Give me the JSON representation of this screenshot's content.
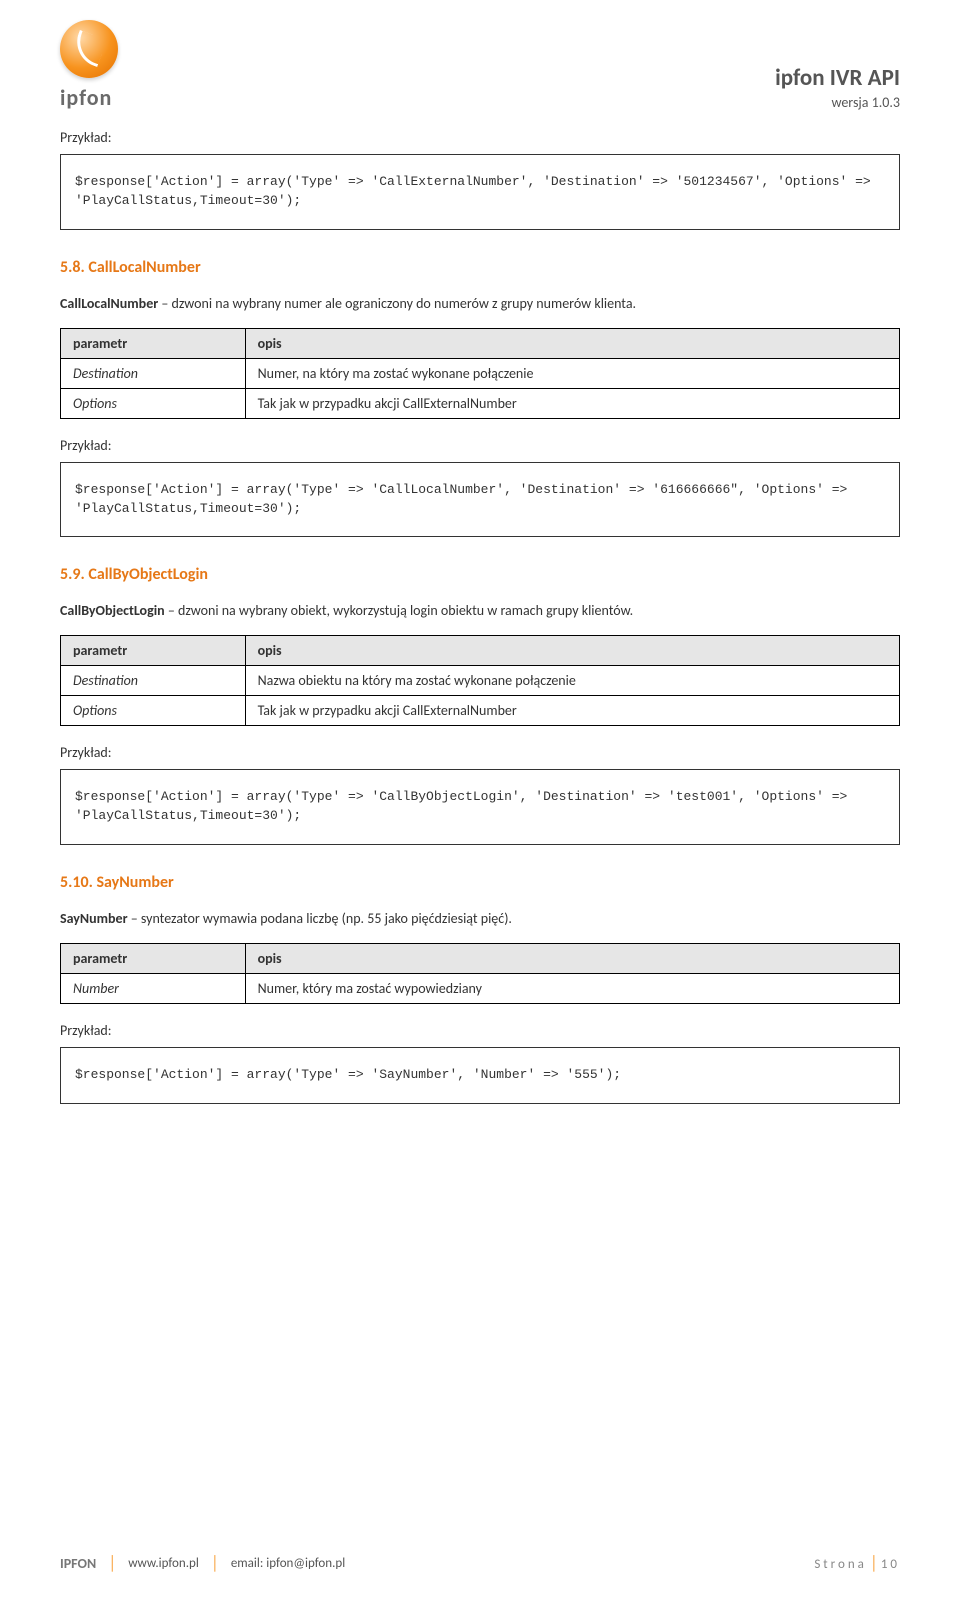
{
  "header": {
    "brand": "ipfon",
    "doc_title": "ipfon IVR API",
    "version": "wersja 1.0.3"
  },
  "example_label": "Przykład:",
  "code": {
    "ex1": "$response['Action'] = array('Type' => 'CallExternalNumber', 'Destination' => '501234567', 'Options' => 'PlayCallStatus,Timeout=30');",
    "ex2": "$response['Action'] = array('Type' => 'CallLocalNumber', 'Destination' => '616666666\", 'Options' => 'PlayCallStatus,Timeout=30');",
    "ex3": "$response['Action'] = array('Type' => 'CallByObjectLogin', 'Destination' => 'test001', 'Options' => 'PlayCallStatus,Timeout=30');",
    "ex4": "$response['Action'] = array('Type' => 'SayNumber', 'Number' => '555');"
  },
  "th": {
    "param": "parametr",
    "desc": "opis"
  },
  "s58": {
    "title": "5.8.   CallLocalNumber",
    "desc_label": "CallLocalNumber",
    "desc_text": " – dzwoni na wybrany numer ale ograniczony do numerów z grupy numerów klienta.",
    "rows": [
      {
        "p": "Destination",
        "d": "Numer, na który ma zostać wykonane połączenie"
      },
      {
        "p": "Options",
        "d": "Tak jak w przypadku akcji CallExternalNumber"
      }
    ]
  },
  "s59": {
    "title": "5.9.   CallByObjectLogin",
    "desc_label": "CallByObjectLogin",
    "desc_text": " – dzwoni na wybrany obiekt, wykorzystują login obiektu w ramach grupy klientów.",
    "rows": [
      {
        "p": "Destination",
        "d": "Nazwa obiektu na który ma zostać wykonane połączenie"
      },
      {
        "p": "Options",
        "d": "Tak jak w przypadku akcji CallExternalNumber"
      }
    ]
  },
  "s510": {
    "title": "5.10.   SayNumber",
    "desc_label": "SayNumber",
    "desc_text": " – syntezator wymawia podana liczbę (np. 55 jako pięćdziesiąt  pięć).",
    "rows": [
      {
        "p": "Number",
        "d": "Numer, który ma zostać wypowiedziany"
      }
    ]
  },
  "footer": {
    "brand": "IPFON",
    "site": "www.ipfon.pl",
    "email_label": "email: ",
    "email": "ipfon@ipfon.pl",
    "page_label": "Strona",
    "page_num": "10"
  }
}
